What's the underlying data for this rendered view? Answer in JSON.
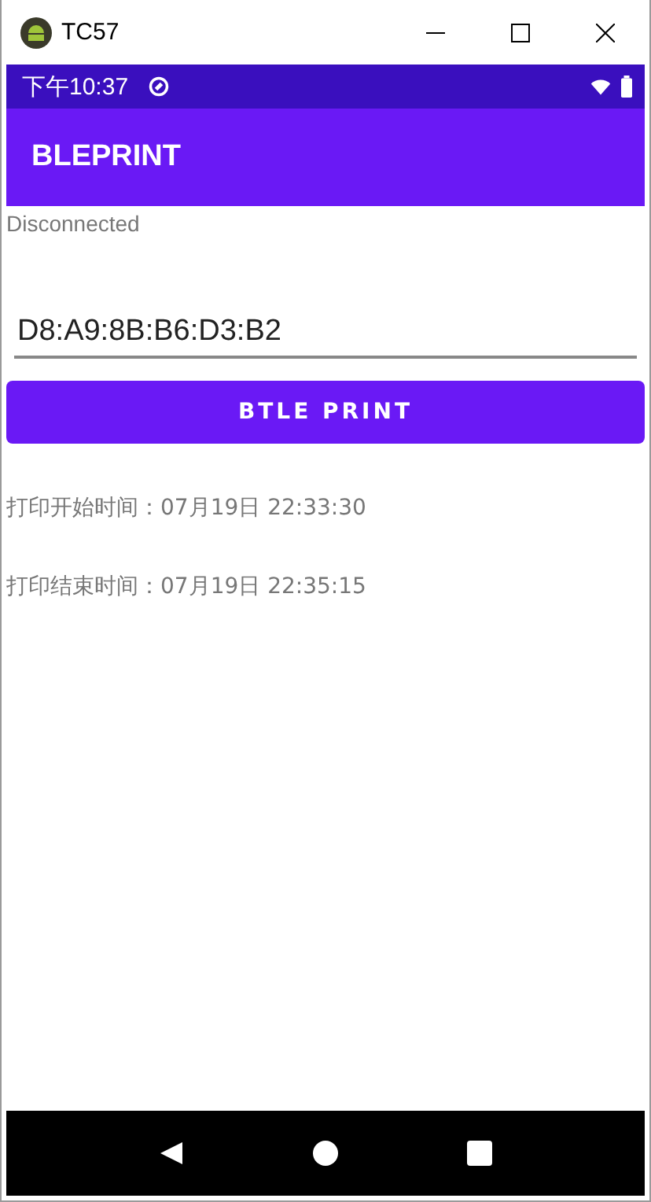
{
  "window": {
    "title": "TC57"
  },
  "status_bar": {
    "time": "下午10:37"
  },
  "app_bar": {
    "title": "BLEPRINT"
  },
  "status_text": "Disconnected",
  "address_field": {
    "value": "D8:A9:8B:B6:D3:B2"
  },
  "print_button": {
    "label": "BTLE PRINT"
  },
  "log_lines": [
    "打印开始时间：07月19日 22:33:30",
    "打印结束时间：07月19日 22:35:15"
  ]
}
